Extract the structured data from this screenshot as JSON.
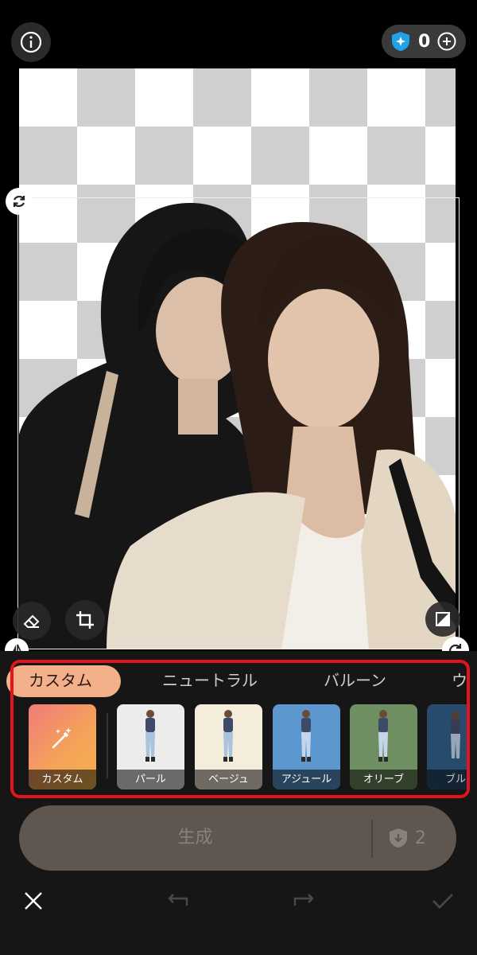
{
  "header": {
    "info_icon": "info-icon",
    "credits": {
      "icon": "sparkle-shield-icon",
      "count": "0",
      "add_icon": "plus-icon"
    }
  },
  "editor": {
    "canvas_background": "transparent-checkerboard",
    "tools": {
      "rotate_icon": "rotate-icon",
      "eraser_icon": "eraser-icon",
      "crop_icon": "crop-icon",
      "layer_icon": "layer-icon",
      "flip_icon": "flip-icon"
    }
  },
  "tabs": [
    {
      "label": "カスタム",
      "active": true
    },
    {
      "label": "ニュートラル",
      "active": false
    },
    {
      "label": "バルーン",
      "active": false
    },
    {
      "label": "ウ",
      "active": false
    }
  ],
  "styles": [
    {
      "label": "カスタム",
      "icon": "magic-wand-icon",
      "color": "#f29a5a"
    },
    {
      "label": "パール",
      "color": "#e9e9e9"
    },
    {
      "label": "ベージュ",
      "color": "#f3ead8"
    },
    {
      "label": "アジュール",
      "color": "#5c97cf"
    },
    {
      "label": "オリーブ",
      "color": "#6f8f62"
    },
    {
      "label": "ブルー",
      "color": "#2c5d8a"
    }
  ],
  "generate": {
    "label": "生成",
    "cost": "2",
    "cost_icon": "shield-download-icon"
  },
  "bottom_bar": {
    "close_icon": "close-icon",
    "undo_icon": "undo-icon",
    "redo_icon": "redo-icon",
    "confirm_icon": "check-icon"
  },
  "colors": {
    "accent": "#f4b08a",
    "highlight": "#e3141b",
    "panel": "#161616"
  }
}
